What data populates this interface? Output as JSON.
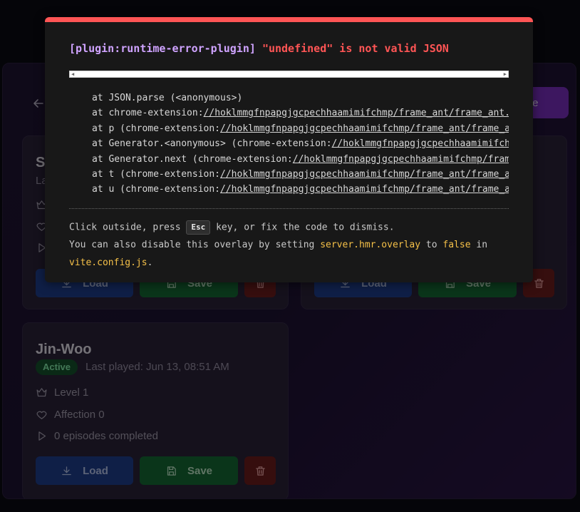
{
  "app": {
    "profile_button": "ofile",
    "cards": [
      {
        "title": "Si",
        "subtitle": "La",
        "load": "Load",
        "save": "Save"
      },
      {
        "load": "Load",
        "save": "Save"
      },
      {
        "title": "Jin-Woo",
        "status": "Active",
        "last_played": "Last played: Jun 13, 08:51 AM",
        "level": "Level 1",
        "affection": "Affection 0",
        "episodes": "0 episodes completed",
        "load": "Load",
        "save": "Save"
      }
    ]
  },
  "overlay": {
    "plugin": "[plugin:runtime-error-plugin]",
    "message": "\"undefined\" is not valid JSON",
    "stack": [
      {
        "prefix": "at JSON.parse (<anonymous>)",
        "url": ""
      },
      {
        "prefix": "at chrome-extension:",
        "url": "//hoklmmgfnpapgjgcpechhaamimifchmp/frame_ant/frame_ant.js"
      },
      {
        "prefix": "at p (chrome-extension:",
        "url": "//hoklmmgfnpapgjgcpechhaamimifchmp/frame_ant/frame_ant.js"
      },
      {
        "prefix": "at Generator.<anonymous> (chrome-extension:",
        "url": "//hoklmmgfnpapgjgcpechhaamimifchmp/frame_ant/frame_ant.js"
      },
      {
        "prefix": "at Generator.next (chrome-extension:",
        "url": "//hoklmmgfnpapgjgcpechhaamimifchmp/frame_ant/frame_ant.js"
      },
      {
        "prefix": "at t (chrome-extension:",
        "url": "//hoklmmgfnpapgjgcpechhaamimifchmp/frame_ant/frame_ant.js"
      },
      {
        "prefix": "at u (chrome-extension:",
        "url": "//hoklmmgfnpapgjgcpechhaamimifchmp/frame_ant/frame_ant.js"
      }
    ],
    "tip1_a": "Click outside, press ",
    "tip1_key": "Esc",
    "tip1_b": " key, or fix the code to dismiss.",
    "tip2_a": "You can also disable this overlay by setting ",
    "tip2_code1": "server.hmr.overlay",
    "tip2_b": " to ",
    "tip2_code2": "false",
    "tip2_c": " in",
    "tip3_code": "vite.config.js",
    "tip3_b": "."
  },
  "colors": {
    "error_red": "#ff5555",
    "plugin_purple": "#cfa3ff",
    "code_yellow": "#f5c048",
    "active_green": "#86efac"
  }
}
